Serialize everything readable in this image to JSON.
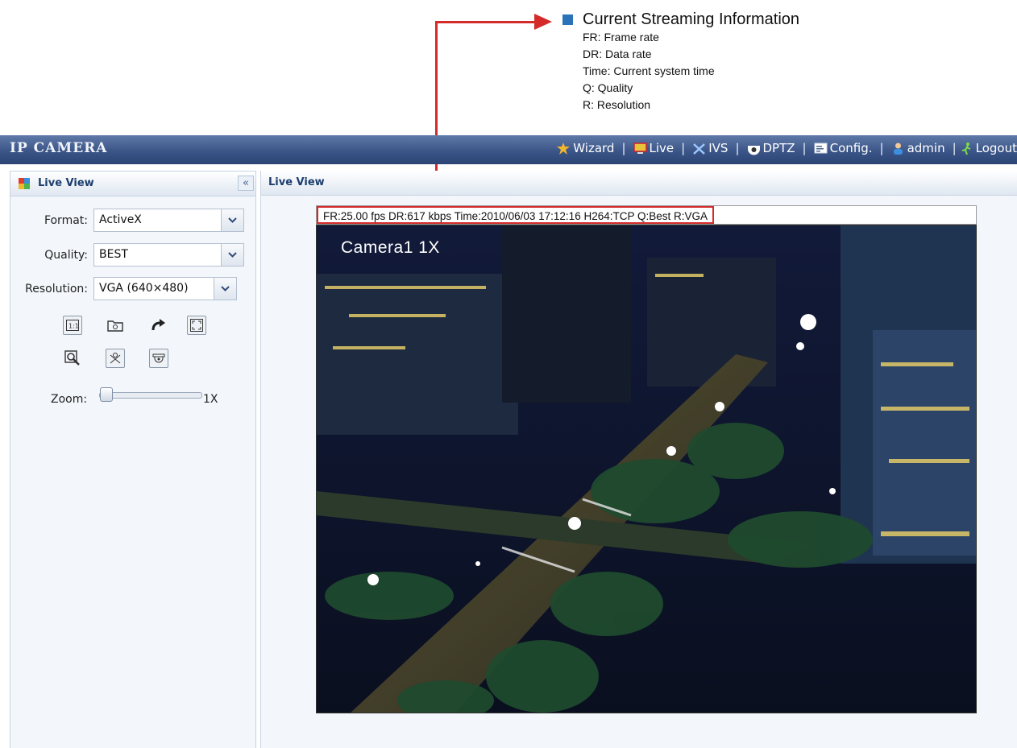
{
  "annotation": {
    "title": "Current Streaming Information",
    "items": [
      "FR: Frame rate",
      "DR: Data rate",
      "Time: Current system time",
      "Q: Quality",
      "R: Resolution"
    ]
  },
  "topbar": {
    "brand": "IP CAMERA",
    "nav": [
      {
        "label": "Wizard",
        "icon": "wizard-icon"
      },
      {
        "label": "Live",
        "icon": "live-icon"
      },
      {
        "label": "IVS",
        "icon": "ivs-icon"
      },
      {
        "label": "DPTZ",
        "icon": "dptz-icon"
      },
      {
        "label": "Config.",
        "icon": "config-icon"
      },
      {
        "label": "admin",
        "icon": "user-icon"
      },
      {
        "label": "Logout",
        "icon": "logout-icon"
      }
    ]
  },
  "left_panel": {
    "title": "Live View",
    "collapse_label": "«",
    "format": {
      "label": "Format:",
      "value": "ActiveX"
    },
    "quality": {
      "label": "Quality:",
      "value": "BEST"
    },
    "resolution": {
      "label": "Resolution:",
      "value": "VGA (640×480)"
    },
    "zoom": {
      "label": "Zoom:",
      "value": "1X"
    }
  },
  "main_panel": {
    "title": "Live View",
    "info_text": "FR:25.00 fps  DR:617 kbps Time:2010/06/03 17:12:16 H264:TCP Q:Best R:VGA",
    "camera_overlay": "Camera1 1X"
  },
  "colors": {
    "topbar": "#3b5588",
    "accent_red": "#d42a2a",
    "annotation_square": "#2a73b8"
  }
}
